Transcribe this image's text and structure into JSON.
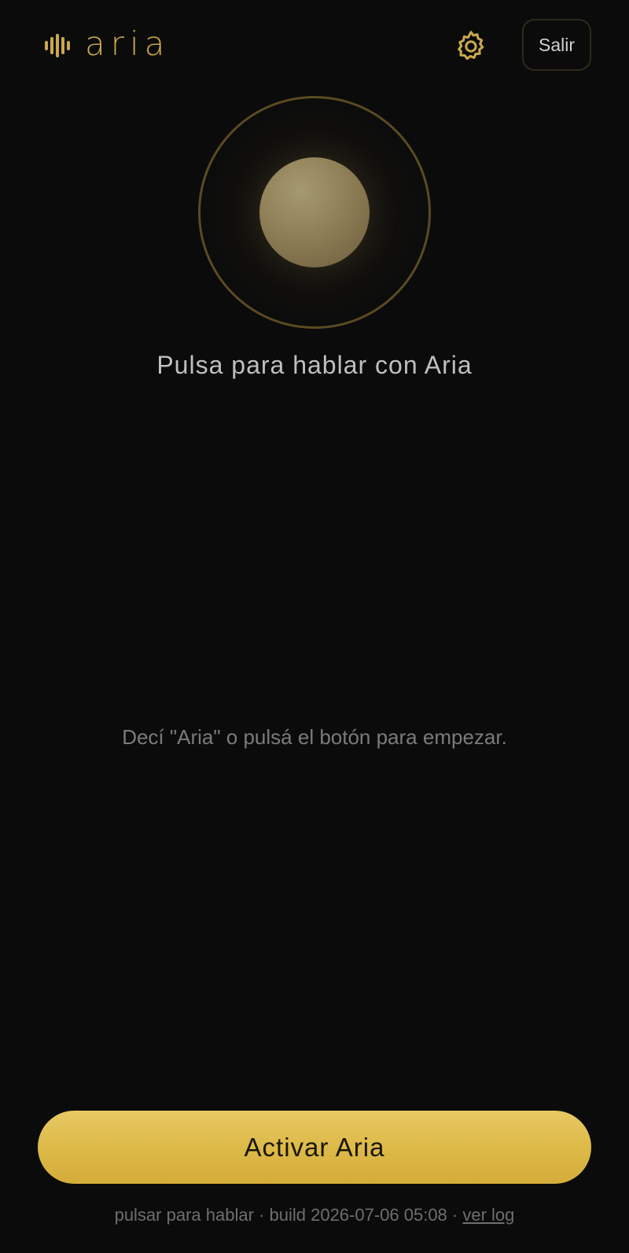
{
  "app": {
    "logo_text": "aria",
    "icons": {
      "logo": "sound-wave-icon",
      "settings": "gear-icon"
    },
    "colors": {
      "background": "#0b0b0b",
      "accent": "#c9a84d",
      "button": "#ddb747"
    }
  },
  "header": {
    "exit_label": "Salir"
  },
  "main": {
    "prompt": "Pulsa para hablar con Aria",
    "hint": "Decí \"Aria\" o pulsá el botón para empezar."
  },
  "bottom": {
    "activate_label": "Activar Aria"
  },
  "footer": {
    "mode": "pulsar para hablar",
    "separator": "·",
    "build": "build 2026-07-06 05:08",
    "log_link": "ver log"
  }
}
